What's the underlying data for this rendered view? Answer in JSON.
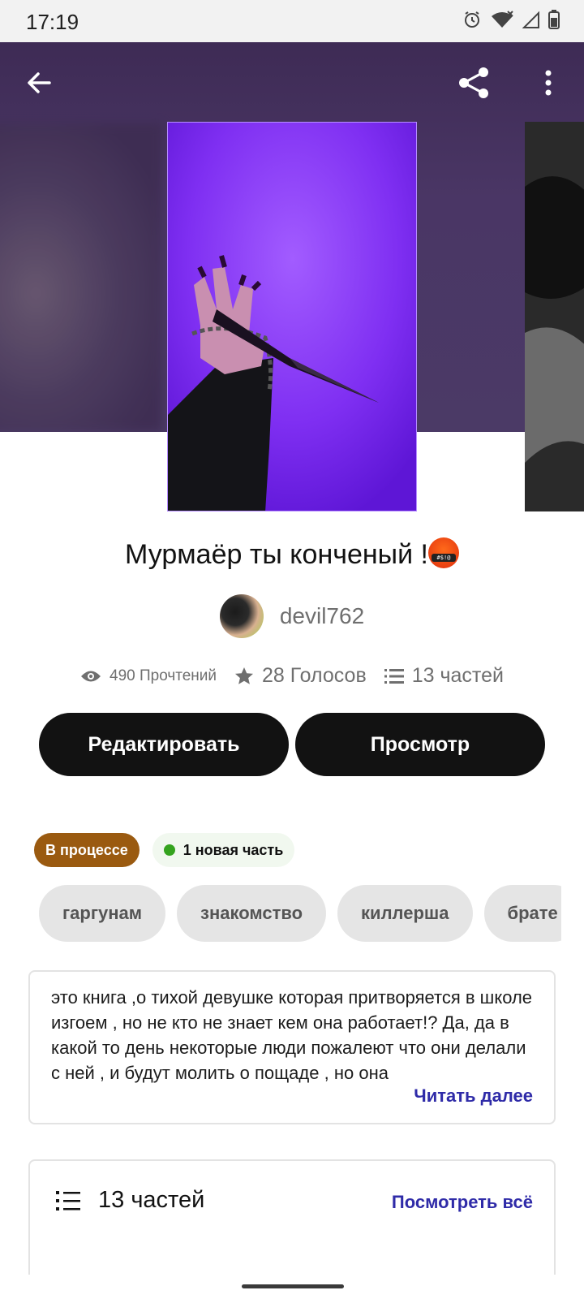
{
  "status_bar": {
    "time": "17:19",
    "icons": [
      "alarm-icon",
      "wifi-icon",
      "signal-icon",
      "battery-icon"
    ]
  },
  "toolbar": {
    "back_icon": "arrow-left-icon",
    "share_icon": "share-icon",
    "more_icon": "more-vertical-icon"
  },
  "story": {
    "title": "Мурмаёр ты конченый !",
    "title_emoji_text": "#$!@",
    "author": "devil762",
    "stats": {
      "reads": "490 Прочтений",
      "votes": "28 Голосов",
      "parts": "13 частей"
    },
    "buttons": {
      "edit": "Редактировать",
      "preview": "Просмотр"
    },
    "status_badge": "В процессе",
    "new_badge": "1 новая часть",
    "tags": [
      "гаргунам",
      "знакомство",
      "киллерша",
      "брате"
    ],
    "description": "это книга ,о тихой девушке которая притворяется в школе изгоем , но не кто не знает кем она работает!? Да, да в какой то день некоторые люди пожалеют что они делали с ней , и будут молить о пощаде , но  она",
    "read_more": "Читать далее"
  },
  "parts_section": {
    "title": "13 частей",
    "see_all": "Посмотреть всё"
  },
  "colors": {
    "accent_link": "#2f2ba8",
    "status_badge": "#9a5a10",
    "new_dot": "#34a31e",
    "button_bg": "#121212",
    "hero_bg": "#4a3665",
    "cover_purple": "#8134f4"
  }
}
